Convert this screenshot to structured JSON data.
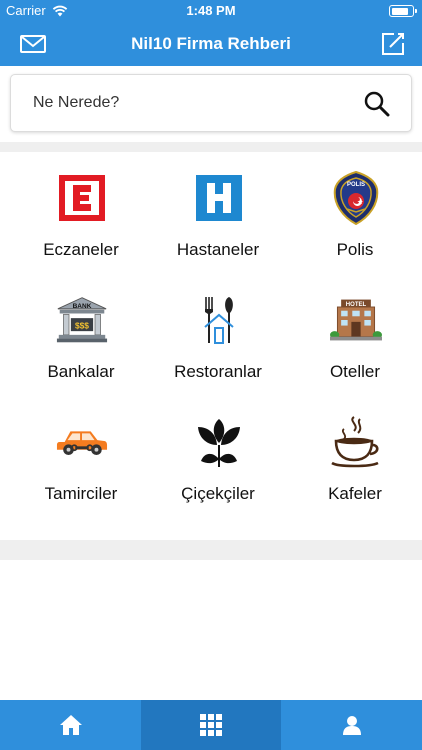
{
  "status_bar": {
    "carrier": "Carrier",
    "time": "1:48 PM"
  },
  "nav": {
    "title": "Nil10 Firma Rehberi",
    "left_icon": "mail-icon",
    "right_icon": "compose-icon"
  },
  "search": {
    "placeholder": "Ne Nerede?",
    "icon": "search-icon"
  },
  "categories": [
    {
      "label": "Eczaneler",
      "icon": "pharmacy-icon"
    },
    {
      "label": "Hastaneler",
      "icon": "hospital-icon"
    },
    {
      "label": "Polis",
      "icon": "police-badge-icon"
    },
    {
      "label": "Bankalar",
      "icon": "bank-icon"
    },
    {
      "label": "Restoranlar",
      "icon": "restaurant-icon"
    },
    {
      "label": "Oteller",
      "icon": "hotel-icon"
    },
    {
      "label": "Tamirciler",
      "icon": "car-repair-icon"
    },
    {
      "label": "Çiçekçiler",
      "icon": "flower-icon"
    },
    {
      "label": "Kafeler",
      "icon": "coffee-icon"
    }
  ],
  "icon_text": {
    "police": "POLIS",
    "bank": "BANK",
    "bank_sign": "$$$",
    "hotel": "HOTEL"
  },
  "tab_bar": [
    {
      "icon": "home-icon",
      "active": false
    },
    {
      "icon": "grid-icon",
      "active": true
    },
    {
      "icon": "user-icon",
      "active": false
    }
  ],
  "colors": {
    "primary": "#2f8fdc",
    "tab_active": "#2277bf",
    "pharmacy_red": "#e21b23",
    "hospital_blue": "#1e88d0"
  }
}
